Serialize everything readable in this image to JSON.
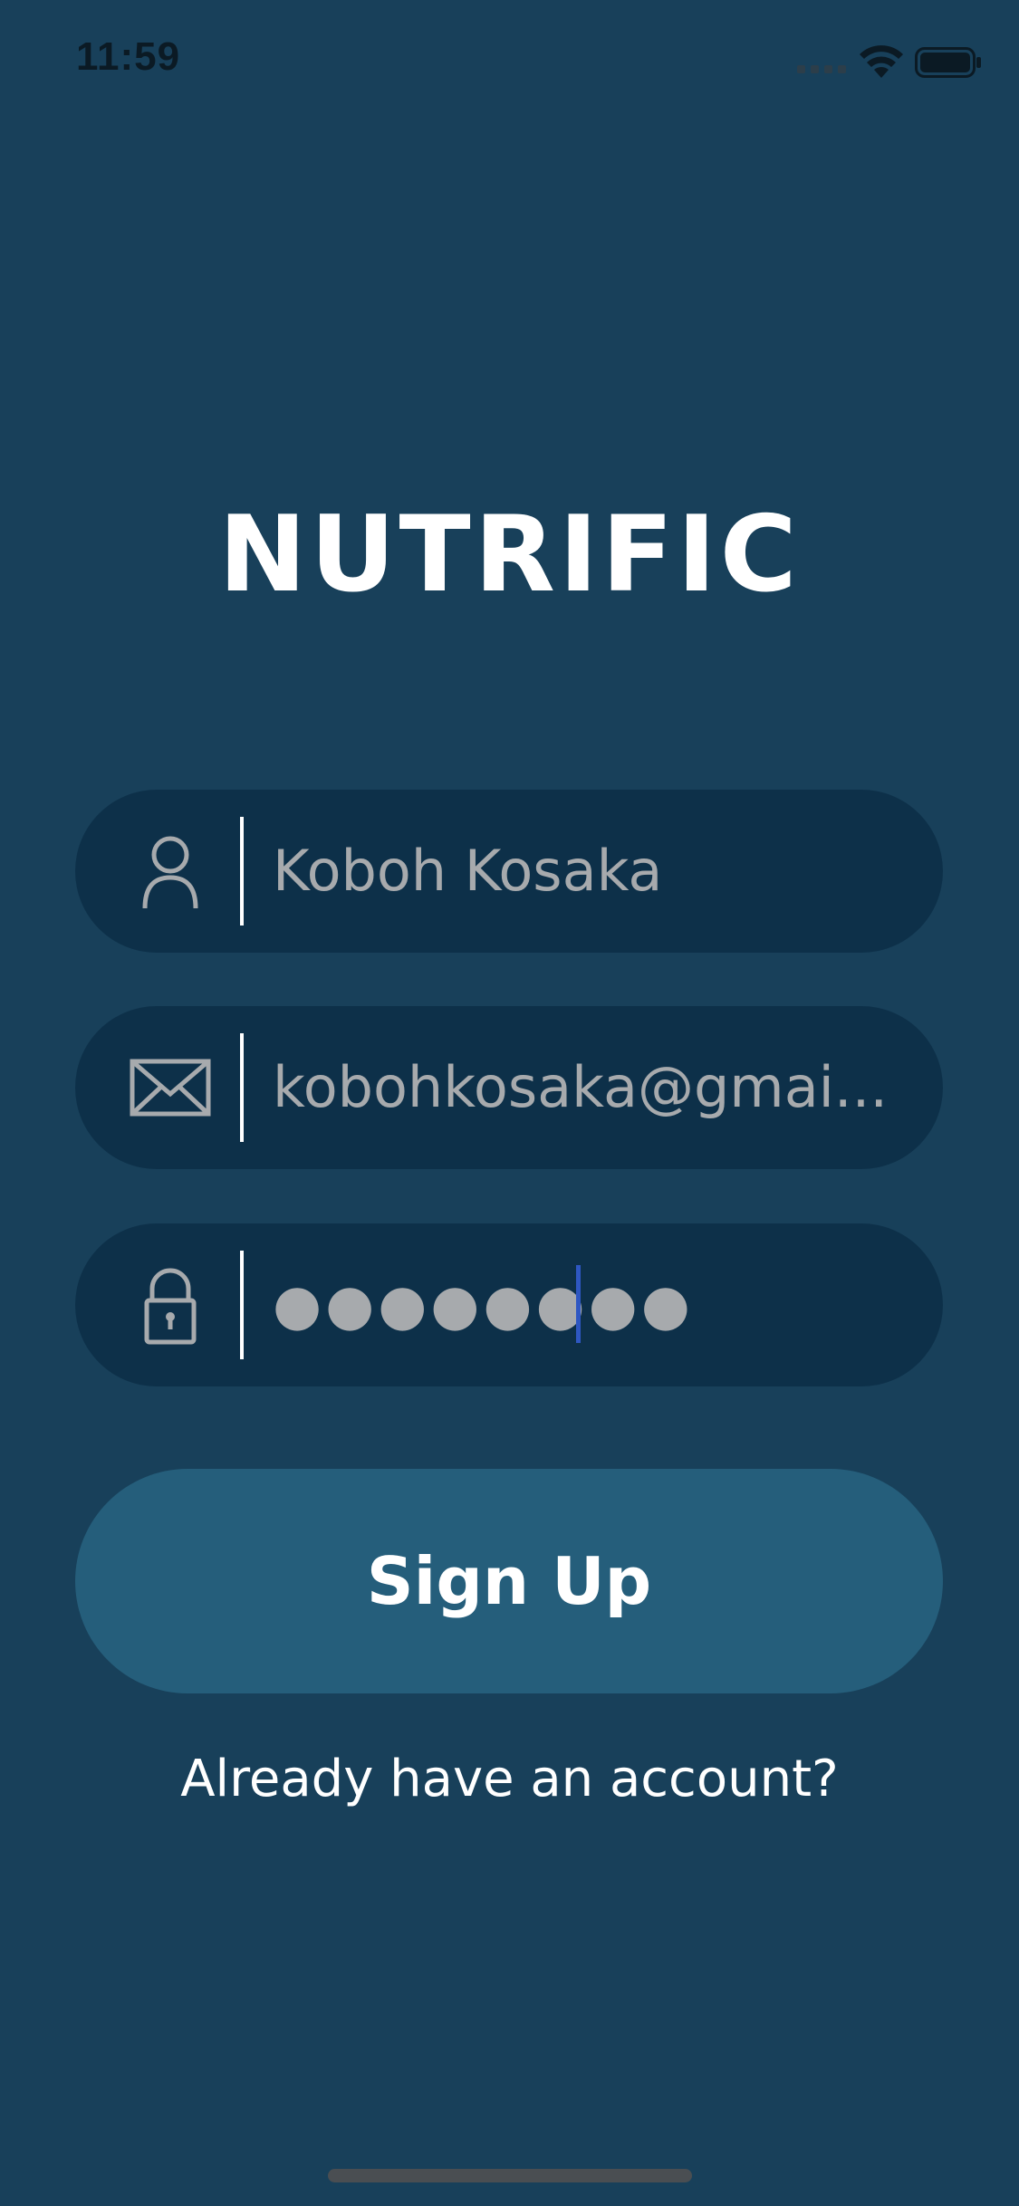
{
  "status_bar": {
    "time": "11:59"
  },
  "app": {
    "title": "NUTRIFIC"
  },
  "form": {
    "name_field": {
      "value": "Koboh Kosaka",
      "icon": "person-icon"
    },
    "email_field": {
      "value": "kobohkosaka@gmai...",
      "icon": "envelope-icon"
    },
    "password_field": {
      "value": "●●●●●●●●",
      "icon": "lock-icon"
    },
    "signup_label": "Sign Up",
    "login_link_label": "Already have an account?"
  },
  "colors": {
    "background": "#18405A",
    "field_background": "#0D3049",
    "button_background": "#255E7B",
    "field_text": "#A7AAAD",
    "cursor": "#2E57C2"
  }
}
